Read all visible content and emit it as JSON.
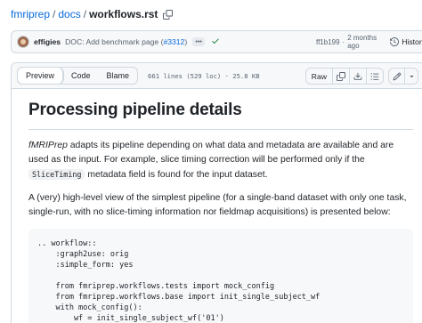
{
  "breadcrumb": {
    "repo": "fmriprep",
    "folder": "docs",
    "file": "workflows.rst",
    "separator": "/"
  },
  "commit": {
    "author": "effigies",
    "message_prefix": "DOC: Add benchmark page (",
    "pr_link": "#3312",
    "message_suffix": ")",
    "ellipsis": "•••",
    "sha": "ff1b199",
    "dot": "·",
    "age": "2 months ago",
    "history_label": "History",
    "status_color": "#1a7f37"
  },
  "file_header": {
    "tabs": [
      {
        "label": "Preview",
        "active": true
      },
      {
        "label": "Code",
        "active": false
      },
      {
        "label": "Blame",
        "active": false
      }
    ],
    "info": "661 lines (529 loc) · 25.8 KB",
    "raw_label": "Raw",
    "icons": [
      "copy-icon",
      "download-icon",
      "list-icon",
      "pencil-icon",
      "triangle-down-icon"
    ]
  },
  "content": {
    "title": "Processing pipeline details",
    "para1_em": "fMRIPrep",
    "para1_text": " adapts its pipeline depending on what data and metadata are available and are used as the input. For example, slice timing correction will be performed only if the ",
    "para1_code": "SliceTiming",
    "para1_end": " metadata field is found for the input dataset.",
    "para2": "A (very) high-level view of the simplest pipeline (for a single-band dataset with only one task, single-run, with no slice-timing information nor fieldmap acquisitions) is presented below:",
    "code_lines": [
      ".. workflow::",
      "    :graph2use: orig",
      "    :simple_form: yes",
      "",
      "    from fmriprep.workflows.tests import mock_config",
      "    from fmriprep.workflows.base import init_single_subject_wf",
      "    with mock_config():",
      "        wf = init_single_subject_wf('01')"
    ]
  },
  "colors": {
    "link": "#0969da",
    "muted": "#59636e",
    "border": "#d1d9e0"
  }
}
